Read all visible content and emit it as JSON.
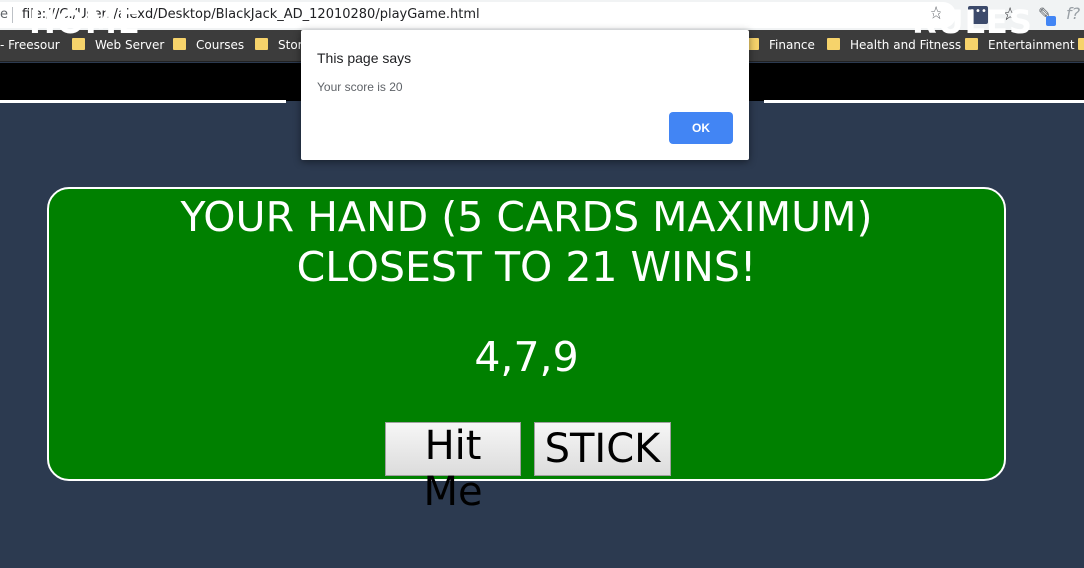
{
  "browser": {
    "scheme_edge": "e",
    "url": "file:///C:/Users/alexd/Desktop/BlackJack_AD_12010280/playGame.html",
    "icons": [
      "star-icon",
      "extension-icon",
      "star-icon",
      "pen-icon",
      "function-icon"
    ]
  },
  "bookmarks": [
    {
      "label": "- Freesour",
      "folder": false
    },
    {
      "label": "Web Server",
      "folder": true
    },
    {
      "label": "Courses",
      "folder": true
    },
    {
      "label": "Stora",
      "folder": true
    },
    {
      "label": "Finance",
      "folder": true
    },
    {
      "label": "Health and Fitness",
      "folder": true
    },
    {
      "label": "Entertainment",
      "folder": true
    }
  ],
  "nav": {
    "home": "HOME",
    "rules": "RULES"
  },
  "dialog": {
    "title": "This page says",
    "message": "Your score is 20",
    "ok_label": "OK"
  },
  "game": {
    "headline_1": "YOUR HAND (5 CARDS MAXIMUM)",
    "headline_2": "CLOSEST TO 21 WINS!",
    "hand": "4,7,9",
    "hit_label": "Hit Me",
    "stick_label": "STICK"
  },
  "colors": {
    "page_bg": "#2c3a50",
    "panel_bg": "#008000",
    "nav_bg": "#000000",
    "dialog_button": "#4285f4"
  }
}
